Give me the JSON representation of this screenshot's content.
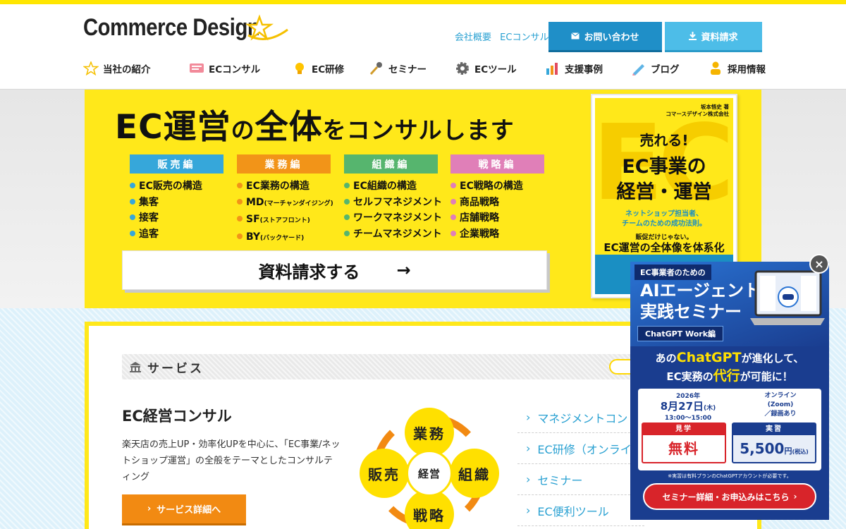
{
  "header": {
    "logo": "Commerce Design",
    "top_links": [
      "会社概要",
      "ECコンサル"
    ],
    "contact_button": "お問い合わせ",
    "document_button": "資料請求"
  },
  "nav": {
    "items": [
      {
        "label": "当社の紹介",
        "icon": "star-icon"
      },
      {
        "label": "ECコンサル",
        "icon": "chat-icon"
      },
      {
        "label": "EC研修",
        "icon": "lightbulb-icon"
      },
      {
        "label": "セミナー",
        "icon": "microphone-icon"
      },
      {
        "label": "ECツール",
        "icon": "gear-icon"
      },
      {
        "label": "支援事例",
        "icon": "bar-chart-icon"
      },
      {
        "label": "ブログ",
        "icon": "pen-icon"
      },
      {
        "label": "採用情報",
        "icon": "person-icon"
      }
    ]
  },
  "hero": {
    "title_a": "EC運営",
    "title_b": "の",
    "title_c": "全体",
    "title_d": "をコンサルします",
    "categories": [
      {
        "title": "販売編",
        "items": [
          {
            "main": "EC販売の構造",
            "small": ""
          },
          {
            "main": "集客",
            "small": ""
          },
          {
            "main": "接客",
            "small": ""
          },
          {
            "main": "追客",
            "small": ""
          }
        ]
      },
      {
        "title": "業務編",
        "items": [
          {
            "main": "EC業務の構造",
            "small": ""
          },
          {
            "main": "MD",
            "small": "(マーチャンダイジング)"
          },
          {
            "main": "SF",
            "small": "(ストアフロント)"
          },
          {
            "main": "BY",
            "small": "(バックヤード)"
          }
        ]
      },
      {
        "title": "組織編",
        "items": [
          {
            "main": "EC組織の構造",
            "small": ""
          },
          {
            "main": "セルフマネジメント",
            "small": ""
          },
          {
            "main": "ワークマネジメント",
            "small": ""
          },
          {
            "main": "チームマネジメント",
            "small": ""
          }
        ]
      },
      {
        "title": "戦略編",
        "items": [
          {
            "main": "EC戦略の構造",
            "small": ""
          },
          {
            "main": "商品戦略",
            "small": ""
          },
          {
            "main": "店舗戦略",
            "small": ""
          },
          {
            "main": "企業戦略",
            "small": ""
          }
        ]
      }
    ],
    "cta": "資料請求する",
    "cta_arrow": "→",
    "book": {
      "bg": "EC",
      "author_1": "坂本悟史",
      "author_2": "コマースデザイン株式会社",
      "author_suffix": "著",
      "catch": "売れる!",
      "title_1": "EC事業の",
      "title_2": "経営・運営",
      "sub_1": "ネットショップ担当者、",
      "sub_2": "チームのための成功法則。",
      "line_1": "販促だけじゃない。",
      "line_2": "EC運営の全体像を体系化"
    }
  },
  "services": {
    "section_title": "サービス",
    "title": "EC経営コンサル",
    "description": "楽天店の売上UP・効率化UPを中心に、「EC事業/ネットショップ運営」の全般をテーマとしたコンサルティング",
    "button": "サービス詳細へ",
    "diagram": {
      "top": "業務",
      "left": "販売",
      "right": "組織",
      "bottom": "戦略",
      "center": "経営"
    },
    "links": [
      "マネジメントコン",
      "EC研修（オンライ",
      "セミナー",
      "EC便利ツール"
    ]
  },
  "popup": {
    "close": "×",
    "kicker": "EC事業者のための",
    "title_1": "AIエージェント",
    "title_2": "実践セミナー",
    "tag": "ChatGPT Work編",
    "mid_1": "あの",
    "mid_brand": "ChatGPT",
    "mid_2": "が進化して、",
    "mid_3": "EC実務の",
    "mid_highlight": "代行",
    "mid_4": "が可能に！",
    "year": "2026年",
    "date": "8月27日",
    "weekday": "(木)",
    "time": "13:00～15:00",
    "online_1": "オンライン",
    "online_2": "(Zoom)",
    "online_3": "／録画あり",
    "tour_label": "見学",
    "tour_value": "無料",
    "practice_label": "実習",
    "practice_value": "5,500",
    "practice_unit": "円",
    "practice_tax": "(税込)",
    "note": "※実習は有料プランのChatGPTアカウントが必要です。",
    "cta": "セミナー詳細・お申込みはこちら"
  }
}
